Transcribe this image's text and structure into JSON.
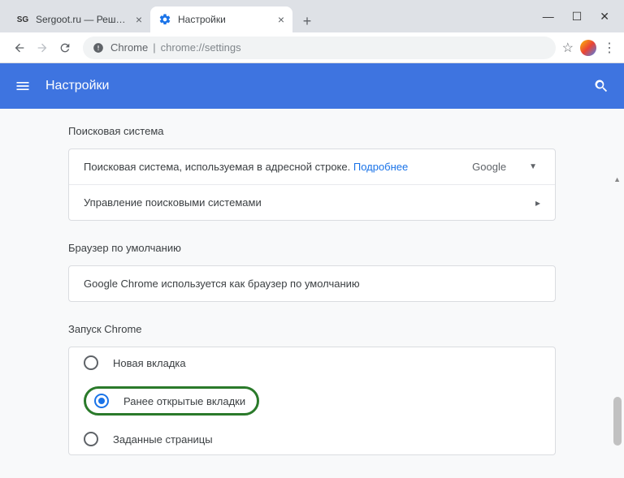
{
  "window": {
    "min": "—",
    "max": "☐",
    "close": "✕"
  },
  "tabs": [
    {
      "title": "Sergoot.ru — Решение ваших п..",
      "active": false
    },
    {
      "title": "Настройки",
      "active": true
    }
  ],
  "newtab": "+",
  "toolbar": {
    "chrome_label": "Chrome",
    "url": "chrome://settings"
  },
  "appbar": {
    "title": "Настройки"
  },
  "sections": {
    "search": {
      "title": "Поисковая система",
      "engine_label": "Поисковая система, используемая в адресной строке.",
      "learn_more": "Подробнее",
      "selected_engine": "Google",
      "manage": "Управление поисковыми системами"
    },
    "default_browser": {
      "title": "Браузер по умолчанию",
      "text": "Google Chrome используется как браузер по умолчанию"
    },
    "startup": {
      "title": "Запуск Chrome",
      "options": [
        "Новая вкладка",
        "Ранее открытые вкладки",
        "Заданные страницы"
      ],
      "selected": 1
    }
  }
}
